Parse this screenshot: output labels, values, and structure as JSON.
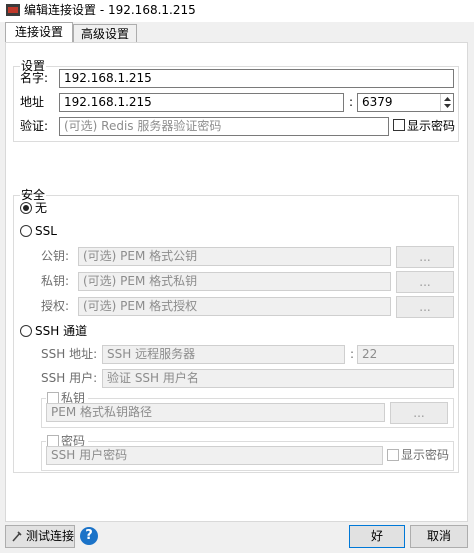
{
  "window": {
    "title": "编辑连接设置 - 192.168.1.215"
  },
  "tabs": [
    {
      "label": "连接设置",
      "active": true
    },
    {
      "label": "高级设置",
      "active": false
    }
  ],
  "settings": {
    "group_label": "设置",
    "name_label": "名字:",
    "name_value": "192.168.1.215",
    "address_label": "地址",
    "address_value": "192.168.1.215",
    "port_sep": ":",
    "port_value": "6379",
    "auth_label": "验证:",
    "auth_placeholder": "(可选) Redis 服务器验证密码",
    "show_password_label": "显示密码"
  },
  "security": {
    "group_label": "安全",
    "none_label": "无",
    "ssl_label": "SSL",
    "ssl_public_key_label": "公钥:",
    "ssl_public_key_placeholder": "(可选) PEM 格式公钥",
    "ssl_private_key_label": "私钥:",
    "ssl_private_key_placeholder": "(可选) PEM 格式私钥",
    "ssl_authority_label": "授权:",
    "ssl_authority_placeholder": "(可选) PEM 格式授权",
    "browse_label": "...",
    "ssh_label": "SSH 通道",
    "ssh_address_label": "SSH 地址:",
    "ssh_address_placeholder": "SSH 远程服务器",
    "ssh_port_sep": ":",
    "ssh_port_value": "22",
    "ssh_user_label": "SSH 用户:",
    "ssh_user_placeholder": "验证 SSH 用户名",
    "private_key_group_label": "私钥",
    "private_key_placeholder": "PEM 格式私钥路径",
    "password_group_label": "密码",
    "ssh_password_placeholder": "SSH 用户密码",
    "ssh_show_password_label": "显示密码"
  },
  "footer": {
    "test_button": "测试连接",
    "ok_button": "好",
    "cancel_button": "取消"
  }
}
